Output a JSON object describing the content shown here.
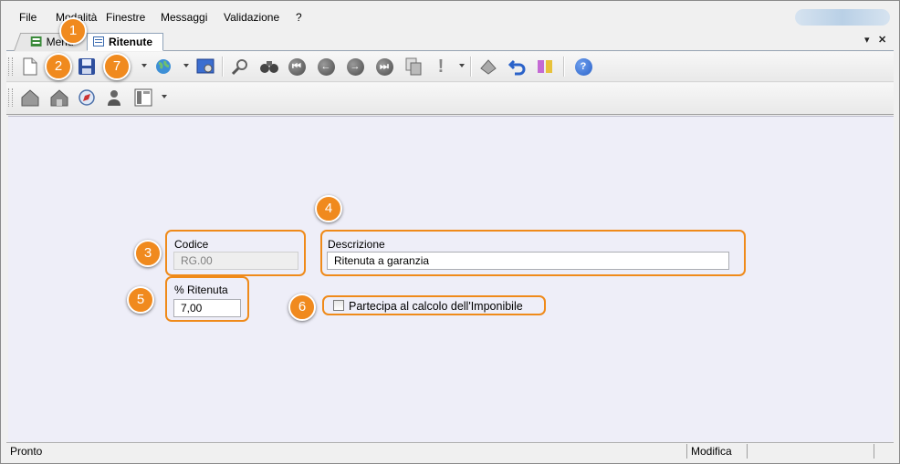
{
  "menubar": {
    "items": [
      "File",
      "Modalità",
      "Finestre",
      "Messaggi",
      "Validazione",
      "?"
    ]
  },
  "tabs": {
    "inactive_label": "Menu",
    "active_label": "Ritenute"
  },
  "toolbar": {
    "icons": [
      "new-document-icon",
      "save-icon",
      "print-icon",
      "globe-icon",
      "settings-screen-icon",
      "search-icon",
      "binoculars-icon",
      "first-record-icon",
      "previous-record-icon",
      "next-record-icon",
      "last-record-icon",
      "copy-record-icon",
      "alert-icon",
      "erase-icon",
      "undo-icon",
      "share-icon",
      "help-icon"
    ]
  },
  "toolbar2": {
    "icons": [
      "house-icon",
      "house-alt-icon",
      "compass-icon",
      "user-icon",
      "layout-icon"
    ]
  },
  "form": {
    "codice_label": "Codice",
    "codice_value": "RG.00",
    "descrizione_label": "Descrizione",
    "descrizione_value": "Ritenuta a garanzia",
    "ritenuta_label": "% Ritenuta",
    "ritenuta_value": "7,00",
    "imponibile_label": "Partecipa al calcolo dell'Imponibile",
    "imponibile_checked": false
  },
  "callouts": {
    "n1": "1",
    "n2": "2",
    "n3": "3",
    "n4": "4",
    "n5": "5",
    "n6": "6",
    "n7": "7"
  },
  "statusbar": {
    "left": "Pronto",
    "right": "Modifica"
  },
  "colors": {
    "callout": "#ef8a1a",
    "form_background": "#eeeef8",
    "help_icon": "#2a62c9"
  }
}
